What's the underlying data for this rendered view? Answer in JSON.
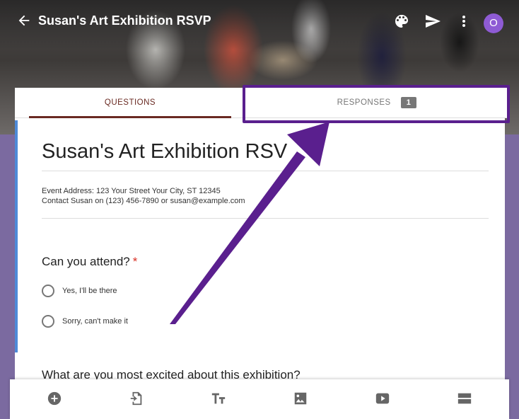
{
  "header": {
    "title": "Susan's Art Exhibition RSVP",
    "avatar_letter": "O"
  },
  "tabs": {
    "questions": "QUESTIONS",
    "responses": "RESPONSES",
    "responses_count": "1"
  },
  "form": {
    "title": "Susan's Art Exhibition RSV",
    "description_line1": "Event Address: 123 Your Street Your City, ST 12345",
    "description_line2": "Contact Susan on (123) 456-7890 or susan@example.com",
    "question1": {
      "label": "Can you attend?",
      "required_mark": "*",
      "options": [
        "Yes,  I'll be there",
        "Sorry, can't make it"
      ]
    },
    "question2": {
      "label": "What are you most excited about this exhibition?"
    }
  },
  "colors": {
    "accent": "#4e8ad8",
    "theme": "#6a2a22",
    "annotation": "#5a1f8e",
    "avatar": "#8e5bd4"
  },
  "icons": [
    "back-arrow-icon",
    "palette-icon",
    "send-icon",
    "more-vert-icon",
    "add-circle-icon",
    "import-icon",
    "text-icon",
    "image-icon",
    "video-icon",
    "section-icon"
  ]
}
